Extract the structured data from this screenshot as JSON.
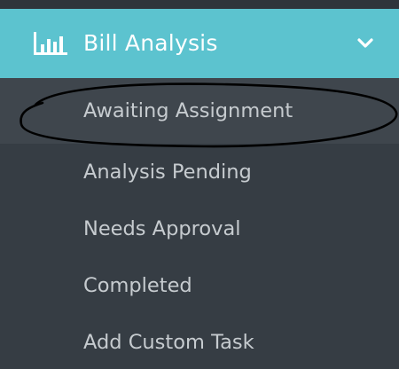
{
  "section": {
    "title": "Bill Analysis",
    "icon": "bar-chart-icon",
    "toggle_icon": "chevron-down-icon",
    "header_color": "#5cc3cf"
  },
  "menu": {
    "items": [
      {
        "label": "Awaiting Assignment",
        "active": true
      },
      {
        "label": "Analysis Pending",
        "active": false
      },
      {
        "label": "Needs Approval",
        "active": false
      },
      {
        "label": "Completed",
        "active": false
      },
      {
        "label": "Add Custom Task",
        "active": false
      }
    ]
  },
  "annotation": {
    "type": "hand-drawn-ellipse",
    "target": "Awaiting Assignment",
    "color": "#000000"
  }
}
